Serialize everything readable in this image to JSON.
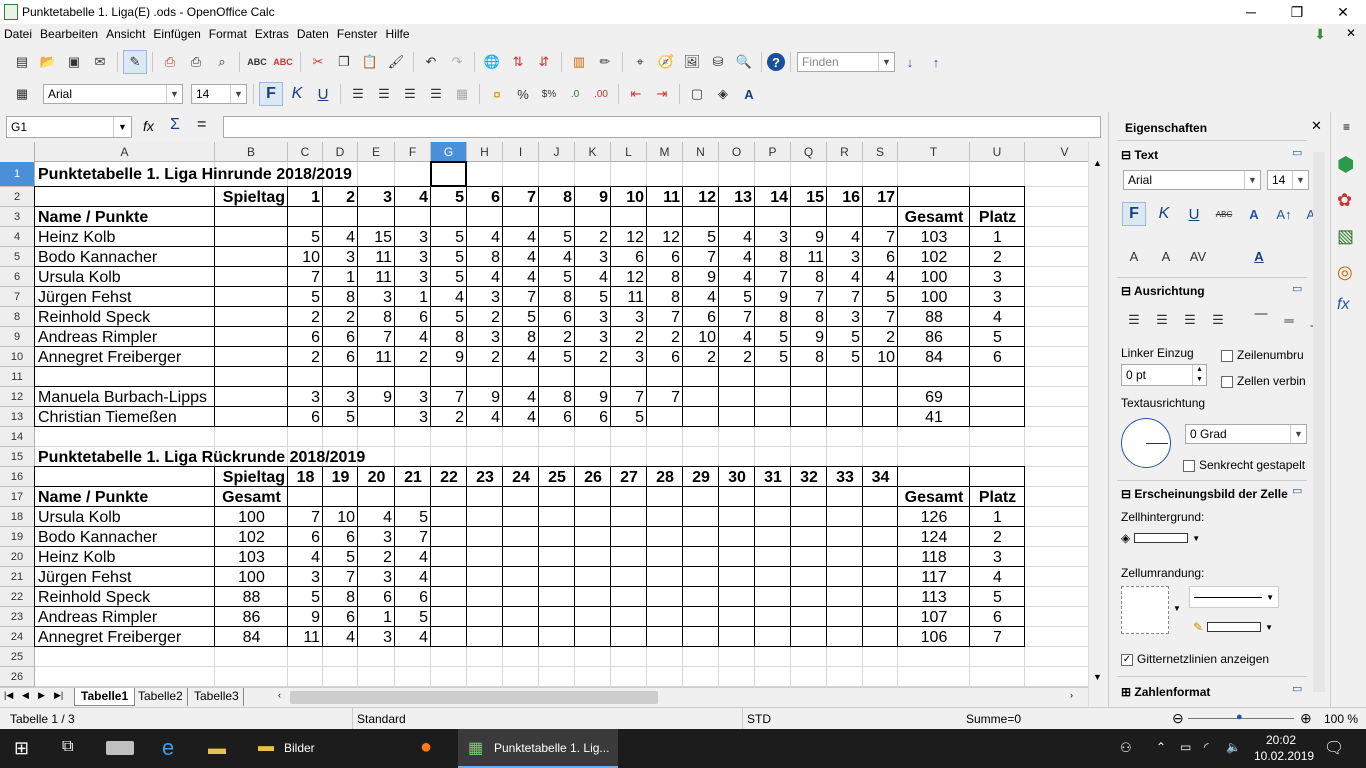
{
  "window": {
    "title": "Punktetabelle 1. Liga(E) .ods - OpenOffice Calc",
    "minimize": "─",
    "restore": "❐",
    "close": "✕"
  },
  "menu": [
    "Datei",
    "Bearbeiten",
    "Ansicht",
    "Einfügen",
    "Format",
    "Extras",
    "Daten",
    "Fenster",
    "Hilfe"
  ],
  "toolbar": {
    "find_placeholder": "Finden"
  },
  "format_toolbar": {
    "font": "Arial",
    "size": "14"
  },
  "formula_bar": {
    "name_box": "G1",
    "content": ""
  },
  "columns": [
    "A",
    "B",
    "C",
    "D",
    "E",
    "F",
    "G",
    "H",
    "I",
    "J",
    "K",
    "L",
    "M",
    "N",
    "O",
    "P",
    "Q",
    "R",
    "S",
    "T",
    "U",
    "V"
  ],
  "rows": [
    "1",
    "2",
    "3",
    "4",
    "5",
    "6",
    "7",
    "8",
    "9",
    "10",
    "11",
    "12",
    "13",
    "14",
    "15",
    "16",
    "17",
    "18",
    "19",
    "20",
    "21",
    "22",
    "23",
    "24",
    "25",
    "26"
  ],
  "sheet": {
    "title1": "Punktetabelle 1. Liga Hinrunde 2018/2019",
    "title2": "Punktetabelle 1. Liga Rückrunde 2018/2019",
    "spieltag": "Spieltag",
    "name_punkte": "Name / Punkte",
    "gesamt": "Gesamt",
    "platz": "Platz",
    "hin_days": [
      "1",
      "2",
      "3",
      "4",
      "5",
      "6",
      "7",
      "8",
      "9",
      "10",
      "11",
      "12",
      "13",
      "14",
      "15",
      "16",
      "17"
    ],
    "rueck_days": [
      "18",
      "19",
      "20",
      "21",
      "22",
      "23",
      "24",
      "25",
      "26",
      "27",
      "28",
      "29",
      "30",
      "31",
      "32",
      "33",
      "34"
    ],
    "hin_rows": [
      {
        "name": "Heinz Kolb",
        "pts": [
          "5",
          "4",
          "15",
          "3",
          "5",
          "4",
          "4",
          "5",
          "2",
          "12",
          "12",
          "5",
          "4",
          "3",
          "9",
          "4",
          "7"
        ],
        "gesamt": "103",
        "platz": "1"
      },
      {
        "name": "Bodo Kannacher",
        "pts": [
          "10",
          "3",
          "11",
          "3",
          "5",
          "8",
          "4",
          "4",
          "3",
          "6",
          "6",
          "7",
          "4",
          "8",
          "11",
          "3",
          "6"
        ],
        "gesamt": "102",
        "platz": "2"
      },
      {
        "name": "Ursula Kolb",
        "pts": [
          "7",
          "1",
          "11",
          "3",
          "5",
          "4",
          "4",
          "5",
          "4",
          "12",
          "8",
          "9",
          "4",
          "7",
          "8",
          "4",
          "4"
        ],
        "gesamt": "100",
        "platz": "3"
      },
      {
        "name": "Jürgen Fehst",
        "pts": [
          "5",
          "8",
          "3",
          "1",
          "4",
          "3",
          "7",
          "8",
          "5",
          "11",
          "8",
          "4",
          "5",
          "9",
          "7",
          "7",
          "5"
        ],
        "gesamt": "100",
        "platz": "3"
      },
      {
        "name": "Reinhold Speck",
        "pts": [
          "2",
          "2",
          "8",
          "6",
          "5",
          "2",
          "5",
          "6",
          "3",
          "3",
          "7",
          "6",
          "7",
          "8",
          "8",
          "3",
          "7"
        ],
        "gesamt": "88",
        "platz": "4"
      },
      {
        "name": "Andreas Rimpler",
        "pts": [
          "6",
          "6",
          "7",
          "4",
          "8",
          "3",
          "8",
          "2",
          "3",
          "2",
          "2",
          "10",
          "4",
          "5",
          "9",
          "5",
          "2"
        ],
        "gesamt": "86",
        "platz": "5"
      },
      {
        "name": "Annegret Freiberger",
        "pts": [
          "2",
          "6",
          "11",
          "2",
          "9",
          "2",
          "4",
          "5",
          "2",
          "3",
          "6",
          "2",
          "2",
          "5",
          "8",
          "5",
          "10"
        ],
        "gesamt": "84",
        "platz": "6"
      }
    ],
    "extra_rows": [
      {
        "name": "Manuela Burbach-Lipps",
        "pts": [
          "3",
          "3",
          "9",
          "3",
          "7",
          "9",
          "4",
          "8",
          "9",
          "7",
          "7",
          "",
          "",
          "",
          "",
          "",
          ""
        ],
        "gesamt": "69",
        "platz": ""
      },
      {
        "name": "Christian Tiemeßen",
        "pts": [
          "6",
          "5",
          "",
          "3",
          "2",
          "4",
          "4",
          "6",
          "6",
          "5",
          "",
          "",
          "",
          "",
          "",
          "",
          ""
        ],
        "gesamt": "41",
        "platz": ""
      }
    ],
    "rueck_rows": [
      {
        "name": "Ursula Kolb",
        "b": "100",
        "pts": [
          "7",
          "10",
          "4",
          "5"
        ],
        "gesamt": "126",
        "platz": "1"
      },
      {
        "name": "Bodo Kannacher",
        "b": "102",
        "pts": [
          "6",
          "6",
          "3",
          "7"
        ],
        "gesamt": "124",
        "platz": "2"
      },
      {
        "name": "Heinz Kolb",
        "b": "103",
        "pts": [
          "4",
          "5",
          "2",
          "4"
        ],
        "gesamt": "118",
        "platz": "3"
      },
      {
        "name": "Jürgen Fehst",
        "b": "100",
        "pts": [
          "3",
          "7",
          "3",
          "4"
        ],
        "gesamt": "117",
        "platz": "4"
      },
      {
        "name": "Reinhold Speck",
        "b": "88",
        "pts": [
          "5",
          "8",
          "6",
          "6"
        ],
        "gesamt": "113",
        "platz": "5"
      },
      {
        "name": "Andreas Rimpler",
        "b": "86",
        "pts": [
          "9",
          "6",
          "1",
          "5"
        ],
        "gesamt": "107",
        "platz": "6"
      },
      {
        "name": "Annegret Freiberger",
        "b": "84",
        "pts": [
          "11",
          "4",
          "3",
          "4"
        ],
        "gesamt": "106",
        "platz": "7"
      }
    ]
  },
  "tabs": [
    "Tabelle1",
    "Tabelle2",
    "Tabelle3"
  ],
  "status": {
    "sheet": "Tabelle 1 / 3",
    "style": "Standard",
    "mode": "STD",
    "sum": "Summe=0",
    "zoom": "100 %"
  },
  "sidebar": {
    "title": "Eigenschaften",
    "text_section": "Text",
    "font": "Arial",
    "size": "14",
    "align_section": "Ausrichtung",
    "indent_label": "Linker Einzug",
    "indent_value": "0 pt",
    "wrap_label": "Zeilenumbru",
    "merge_label": "Zellen verbin",
    "text_orient_label": "Textausrichtung",
    "angle_value": "0 Grad",
    "stacked_label": "Senkrecht gestapelt",
    "appearance_section": "Erscheinungsbild der Zelle",
    "bg_label": "Zellhintergrund:",
    "border_label": "Zellumrandung:",
    "gridlines_label": "Gitternetzlinien anzeigen",
    "number_section": "Zahlenformat"
  },
  "taskbar": {
    "explorer_label": "Bilder",
    "calc_label": "Punktetabelle 1. Lig...",
    "time": "20:02",
    "date": "10.02.2019"
  }
}
